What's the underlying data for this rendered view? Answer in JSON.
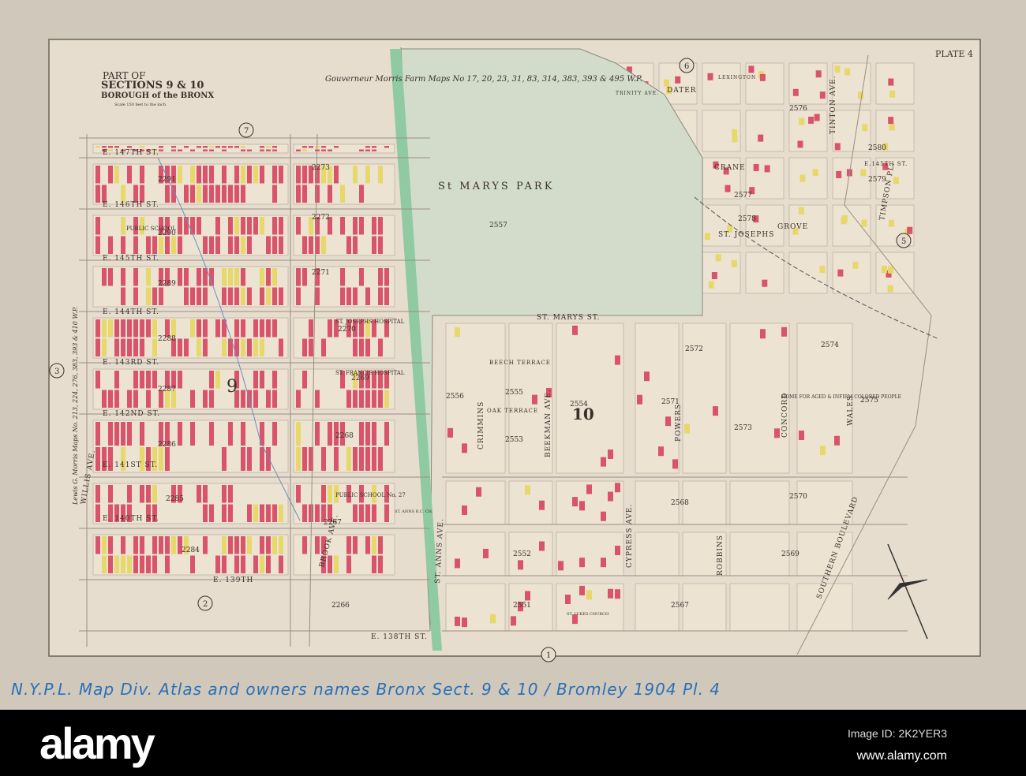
{
  "plate": "PLATE 4",
  "title": {
    "line1": "PART OF",
    "line2": "SECTIONS 9 & 10",
    "line3": "BOROUGH of the BRONX",
    "scale": "Scale 150 feet to the inch"
  },
  "farm_note": "Gouverneur Morris Farm Maps No 17, 20, 23, 31, 83, 314, 383, 393 & 495 W.P.",
  "side_note": "Lewis G. Morris Maps No. 213, 224, 276, 383, 393 & 410 W.P.",
  "park": {
    "name": "St MARYS PARK",
    "block": "2557"
  },
  "sections": {
    "s9": "9",
    "s10": "10"
  },
  "circled": [
    "1",
    "2",
    "3",
    "5",
    "6",
    "7"
  ],
  "streets": {
    "e147": "E. 147TH ST.",
    "e146": "E. 146TH ST.",
    "e145": "E. 145TH ST.",
    "e144": "E. 144TH ST.",
    "e143": "E. 143RD ST.",
    "e142": "E. 142ND ST.",
    "e141": "E. 141ST ST.",
    "e140": "E. 140TH ST.",
    "e139": "E. 139TH",
    "e138": "E. 138TH ST.",
    "willis": "WILLIS AVE.",
    "brook": "BROOK AVE.",
    "stanns": "ST. ANNS AVE.",
    "crimmins": "CRIMMINS",
    "beekman": "BEEKMAN AVE.",
    "cypress": "CYPRESS AVE.",
    "powers": "POWERS",
    "robbins": "ROBBINS",
    "southern": "SOUTHERN BOULEVARD",
    "concord": "CONCORD",
    "wales": "WALES",
    "stmarys": "ST. MARYS ST.",
    "dater": "DATER",
    "crane": "CRANE",
    "stjosephs": "ST. JOSEPHS",
    "grove": "GROVE",
    "trinity": "TRINITY AVE.",
    "timpson": "TIMPSON PL.",
    "tinton": "TINTON AVE.",
    "beech": "BEECH TERRACE",
    "oak": "OAK TERRACE",
    "lexington": "LEXINGTON",
    "e145b": "E.145TH ST."
  },
  "institutions": {
    "stjoseph": "ST. JOSEPHS HOSPITAL",
    "stfrancis": "ST. FRANCIS HOSPITAL",
    "ps": "PUBLIC SCHOOL",
    "ps2": "PUBLIC SCHOOL No. 27",
    "home": "HOME FOR AGED & INFIRM COLORED PEOPLE",
    "church": "ST. LUKES CHURCH",
    "stannes": "ST. ANNS R.C. CH."
  },
  "blocks": [
    "2291",
    "2273",
    "2290",
    "2272",
    "2289",
    "2271",
    "2288",
    "2270",
    "2287",
    "2269",
    "2286",
    "2268",
    "2285",
    "2267",
    "2284",
    "2266",
    "2556",
    "2555",
    "2554",
    "2553",
    "2552",
    "2551",
    "2571",
    "2572",
    "2573",
    "2574",
    "2575",
    "2568",
    "2570",
    "2569",
    "2567",
    "2576",
    "2577",
    "2578",
    "2580",
    "2579"
  ],
  "handwritten_note": "N.Y.P.L. Map Div. Atlas and owners names Bronx Sect. 9 & 10 / Bromley 1904 Pl. 4",
  "watermark": {
    "logo": "alamy",
    "image_id": "Image ID: 2K2YER3",
    "site": "www.alamy.com"
  }
}
